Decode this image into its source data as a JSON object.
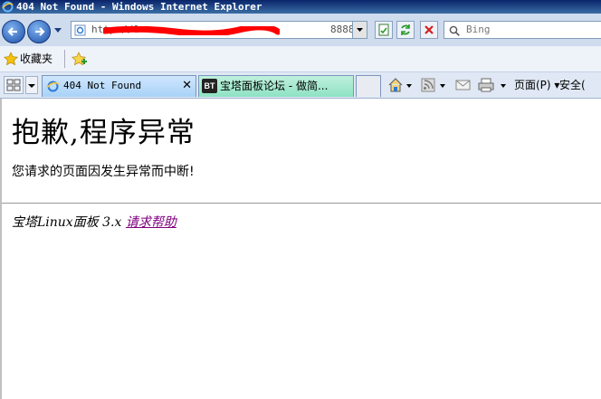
{
  "window": {
    "title": "404 Not Found - Windows Internet Explorer"
  },
  "address_bar": {
    "url": "http://1",
    "url_tail": "8888/"
  },
  "search": {
    "placeholder": "Bing"
  },
  "favorites": {
    "label": "收藏夹"
  },
  "tabs": [
    {
      "label": "404 Not Found",
      "active": true
    },
    {
      "label": "宝塔面板论坛 - 做简...",
      "badge": "BT"
    }
  ],
  "command_bar": {
    "page_menu": "页面(P)",
    "safety_menu": "安全("
  },
  "page": {
    "heading": "抱歉,程序异常",
    "message": "您请求的页面因发生异常而中断!",
    "footer_text": "宝塔Linux面板 3.x ",
    "help_link": "请求帮助"
  },
  "colors": {
    "title_bar": "#0a246a",
    "link_visited": "#800080",
    "redaction": "#ff0000"
  }
}
